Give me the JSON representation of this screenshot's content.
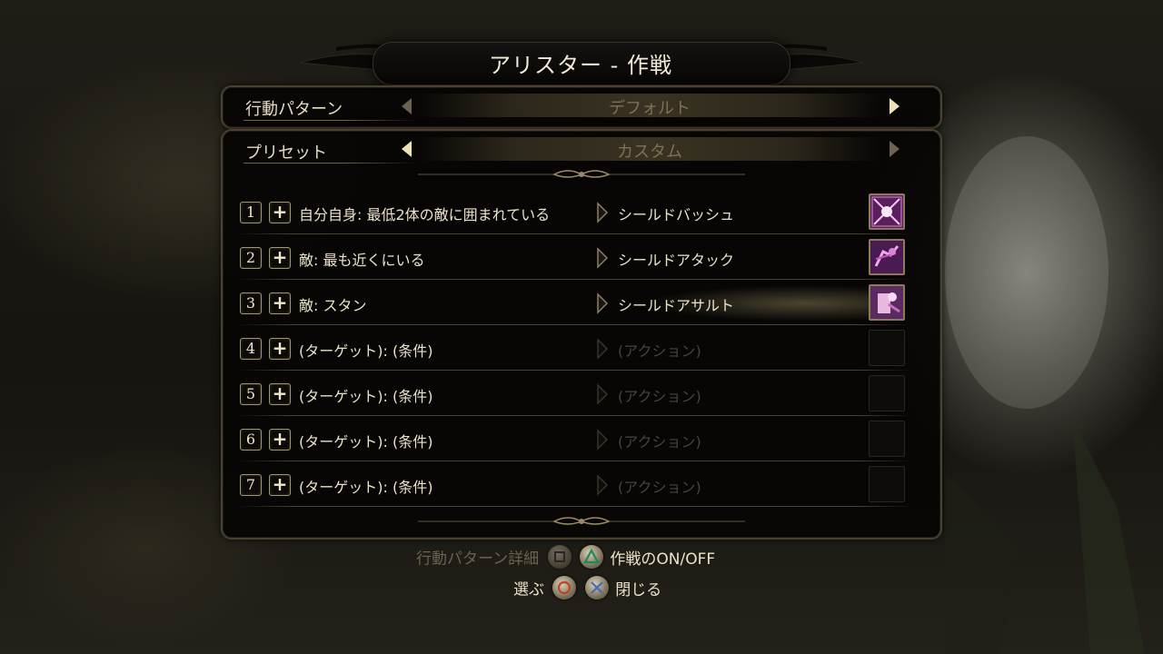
{
  "title": "アリスター - 作戦",
  "behavior": {
    "label": "行動パターン",
    "value": "デフォルト"
  },
  "preset": {
    "label": "プリセット",
    "value": "カスタム"
  },
  "tactics": [
    {
      "number": "1",
      "condition": "自分自身: 最低2体の敵に囲まれている",
      "action": "シールドバッシュ",
      "icon": "shield-bash-skill-icon",
      "empty": false
    },
    {
      "number": "2",
      "condition": "敵: 最も近くにいる",
      "action": "シールドアタック",
      "icon": "shield-attack-skill-icon",
      "empty": false
    },
    {
      "number": "3",
      "condition": "敵: スタン",
      "action": "シールドアサルト",
      "icon": "shield-assault-skill-icon",
      "empty": false
    },
    {
      "number": "4",
      "condition": "(ターゲット): (条件)",
      "action": "(アクション)",
      "empty": true
    },
    {
      "number": "5",
      "condition": "(ターゲット): (条件)",
      "action": "(アクション)",
      "empty": true
    },
    {
      "number": "6",
      "condition": "(ターゲット): (条件)",
      "action": "(アクション)",
      "empty": true
    },
    {
      "number": "7",
      "condition": "(ターゲット): (条件)",
      "action": "(アクション)",
      "empty": true
    }
  ],
  "footer": {
    "behavior_detail": "行動パターン詳細",
    "tactics_toggle": "作戦のON/OFF",
    "select": "選ぶ",
    "close": "閉じる"
  },
  "colors": {
    "accent": "#e8dcc0",
    "disabled": "#6b634f",
    "skill": "#c040c8"
  }
}
